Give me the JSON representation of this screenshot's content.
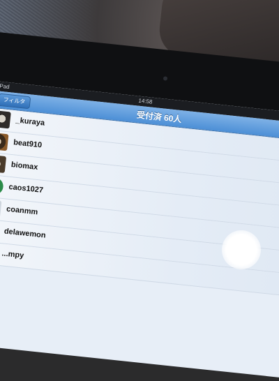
{
  "status_bar": {
    "carrier": "iPad",
    "time": "14:58"
  },
  "nav_bar": {
    "filter_button": "フィルタ",
    "title": "受付済 60人"
  },
  "users": [
    {
      "name": "_kuraya",
      "icon": "avatar-photo"
    },
    {
      "name": "beat910",
      "icon": "avatar-photo"
    },
    {
      "name": "biomax",
      "icon": "avatar-photo"
    },
    {
      "name": "caos1027",
      "icon": "avatar-photo"
    },
    {
      "name": "coanmm",
      "icon": "avatar-placeholder"
    },
    {
      "name": "delawemon",
      "icon": "avatar-placeholder"
    },
    {
      "name": "...mpy",
      "icon": "avatar-placeholder"
    }
  ]
}
